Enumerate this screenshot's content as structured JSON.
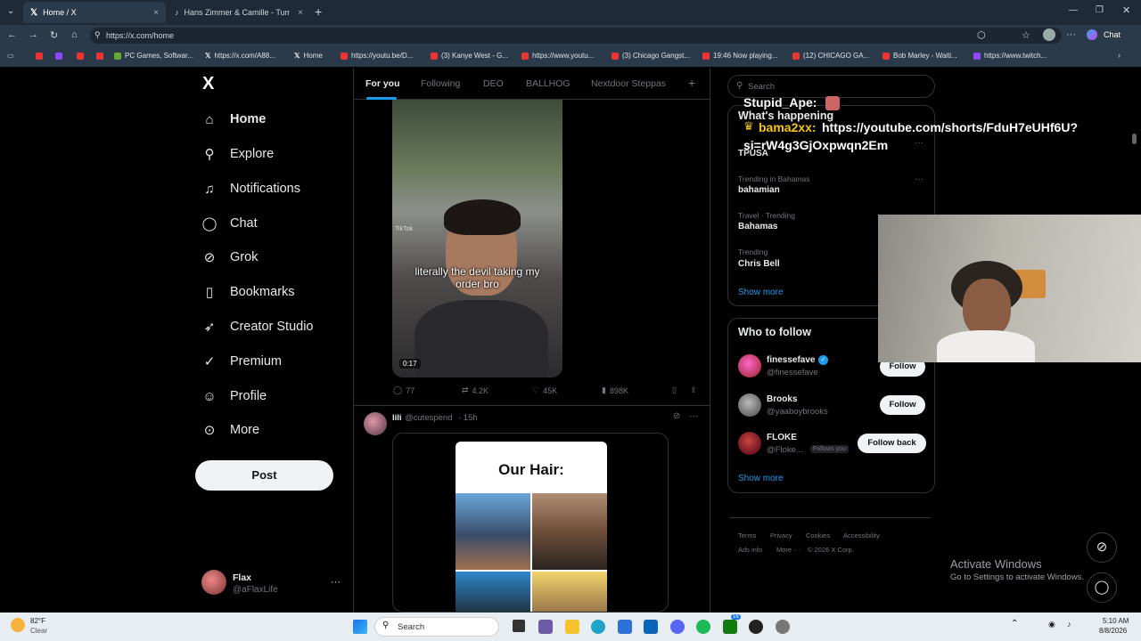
{
  "browser": {
    "tabs": [
      {
        "title": "Home / X",
        "close": "×"
      },
      {
        "title": "Hans Zimmer & Camille - Tumarc",
        "close": "×"
      }
    ],
    "new_tab": "+",
    "url": "https://x.com/home",
    "chat_label": "Chat",
    "bookmarks": [
      "PC Games, Softwar...",
      "https://x.com/A88...",
      "Home",
      "https://youtu.be/D...",
      "(3) Kanye West - G...",
      "https://www.youtu...",
      "(3) Chicago Gangst...",
      "19:46 Now playing...",
      "(12) CHICAGO GA...",
      "Bob Marley - Waiti...",
      "https://www.twitch..."
    ]
  },
  "sidebar": {
    "logo": "X",
    "items": [
      {
        "label": "Home",
        "icon": "home-icon"
      },
      {
        "label": "Explore",
        "icon": "search-icon"
      },
      {
        "label": "Notifications",
        "icon": "bell-icon"
      },
      {
        "label": "Chat",
        "icon": "chat-icon"
      },
      {
        "label": "Grok",
        "icon": "grok-icon"
      },
      {
        "label": "Bookmarks",
        "icon": "bookmark-icon"
      },
      {
        "label": "Creator Studio",
        "icon": "rocket-icon"
      },
      {
        "label": "Premium",
        "icon": "verified-icon"
      },
      {
        "label": "Profile",
        "icon": "person-icon"
      },
      {
        "label": "More",
        "icon": "more-circle-icon"
      }
    ],
    "post_label": "Post",
    "user": {
      "name": "Flax",
      "handle": "@aFlaxLife",
      "menu": "···"
    }
  },
  "feed": {
    "tabs": [
      "For you",
      "Following",
      "DEO",
      "BALLHOG",
      "Nextdoor Steppas"
    ],
    "add_tab": "+",
    "post1": {
      "caption": "literally the devil taking my order bro",
      "duration": "0:17",
      "watermark": "TikTok",
      "replies": "77",
      "reposts": "4.2K",
      "likes": "45K",
      "views": "898K"
    },
    "post2": {
      "name": "lili",
      "handle": "@cutespend",
      "time": "· 15h",
      "image_text": "Our Hair:"
    }
  },
  "right": {
    "search_placeholder": "Search",
    "happening_title": "What's happening",
    "trends": [
      {
        "meta": "",
        "name": "TPUSA"
      },
      {
        "meta": "Trending in Bahamas",
        "name": "bahamian"
      },
      {
        "meta": "Travel · Trending",
        "name": "Bahamas"
      },
      {
        "meta": "Trending",
        "name": "Chris Bell"
      }
    ],
    "show_more": "Show more",
    "wtf_title": "Who to follow",
    "follow": [
      {
        "name": "finessefave",
        "handle": "@finessefave",
        "button": "Follow"
      },
      {
        "name": "Brooks",
        "handle": "@yaaboybrooks",
        "button": "Follow"
      },
      {
        "name": "FLOKE",
        "handle": "@Floke...",
        "badge": "Follows you",
        "button": "Follow back"
      }
    ],
    "show_more2": "Show more",
    "footer": [
      "Terms",
      "Privacy",
      "Cookies",
      "Accessibility",
      "Ads info",
      "More ···",
      "© 2026 X Corp."
    ]
  },
  "overlay": {
    "chat_user1": "Stupid_Ape:",
    "chat_user2": "bama2xx:",
    "chat_msg": "https://youtube.com/shorts/FduH7eUHf6U?",
    "chat_msg2": "si=rW4g3GjOxpwqn2Em",
    "activate_title": "Activate Windows",
    "activate_sub": "Go to Settings to activate Windows."
  },
  "taskbar": {
    "weather_temp": "82°F",
    "weather_desc": "Clear",
    "search": "Search",
    "time": "5:10 AM",
    "date": "8/8/2026",
    "badge": "16"
  },
  "colors": {
    "accent": "#1d9bf0",
    "bg": "#000000",
    "border": "#2f3336"
  }
}
